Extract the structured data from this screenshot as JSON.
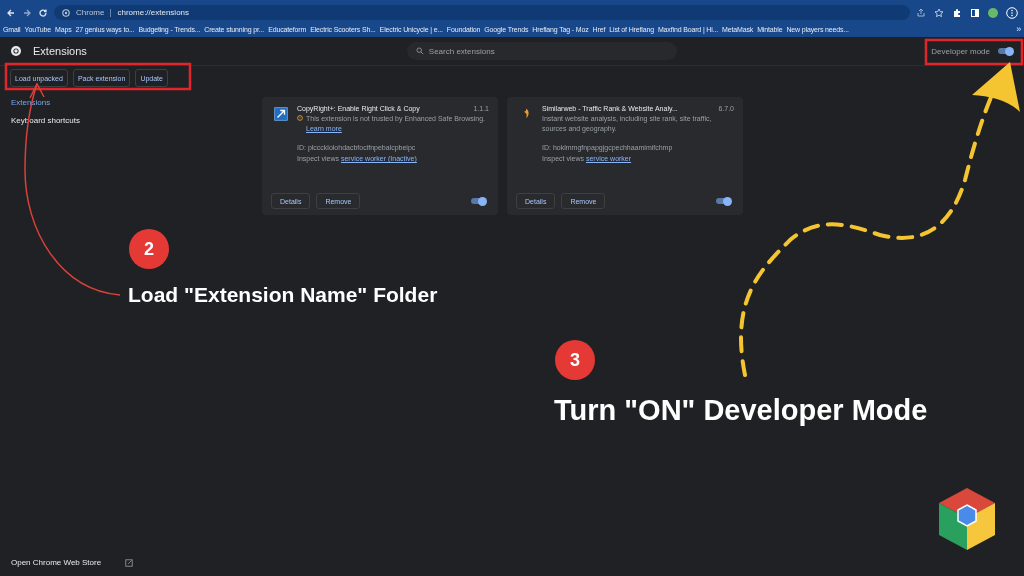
{
  "browser": {
    "site_label": "Chrome",
    "url": "chrome://extensions",
    "bookmarks": [
      "Gmail",
      "YouTube",
      "Maps",
      "27 genius ways to...",
      "Budgeting - Trends...",
      "Create stunning pr...",
      "Educateform",
      "Electric Scooters Sh...",
      "Electric Unicycle | e...",
      "Foundation",
      "Google Trends",
      "Hreflang Tag - Moz",
      "Href",
      "List of Hreflang",
      "Maxfind Board | Hi...",
      "MetaMask",
      "Mintable",
      "New players needs..."
    ],
    "more": "»"
  },
  "page": {
    "title": "Extensions",
    "search": {
      "placeholder": "Search extensions"
    },
    "developer_mode": {
      "label": "Developer mode",
      "on": true
    },
    "toolbar": [
      "Load unpacked",
      "Pack extension",
      "Update"
    ],
    "sidebar": [
      {
        "label": "Extensions",
        "selected": true
      },
      {
        "label": "Keyboard shortcuts",
        "selected": false
      }
    ],
    "cards": [
      {
        "name": "CopyRight+: Enable Right Click & Copy",
        "version": "1.1.1",
        "warning": "This extension is not trusted by Enhanced Safe Browsing.",
        "warning_link": "Learn more",
        "id": "ID: plcccklolohdacbfocifnpebalcpbeipc",
        "inspect": "Inspect views",
        "inspect_link": "service worker (Inactive)",
        "details": "Details",
        "remove": "Remove",
        "enabled": true
      },
      {
        "name": "Similarweb - Traffic Rank & Website Analy...",
        "version": "6.7.0",
        "description": "Instant website analysis, including site rank, site traffic, sources and geography.",
        "id": "ID: hoklmmgfnpapgjgcpechhaamimifchmp",
        "inspect": "Inspect views",
        "inspect_link": "service worker",
        "details": "Details",
        "remove": "Remove",
        "enabled": true
      }
    ],
    "footer": "Open Chrome Web Store"
  },
  "annotations": [
    {
      "number": "2",
      "text": "Load \"Extension Name\" Folder"
    },
    {
      "number": "3",
      "text": "Turn \"ON\" Developer Mode"
    }
  ]
}
